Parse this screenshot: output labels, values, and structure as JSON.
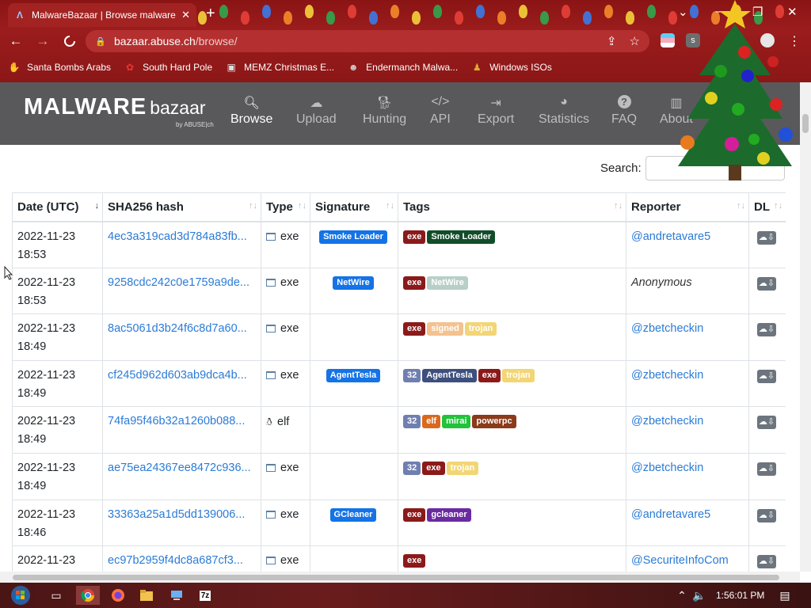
{
  "browser": {
    "tab_title": "MalwareBazaar | Browse malware",
    "url_domain": "bazaar.abuse.ch",
    "url_path": "/browse/",
    "bookmarks": [
      {
        "label": "Santa Bombs Arabs",
        "icon": "bomb-icon"
      },
      {
        "label": "South Hard Pole",
        "icon": "flower-icon"
      },
      {
        "label": "MEMZ Christmas E...",
        "icon": "image-icon"
      },
      {
        "label": "Endermanch Malwa...",
        "icon": "raccoon-icon"
      },
      {
        "label": "Windows ISOs",
        "icon": "person-icon"
      }
    ]
  },
  "site": {
    "logo_main": "MALWARE",
    "logo_sub": "bazaar",
    "logo_by": "by ABUSE|ch",
    "menu": [
      {
        "label": "Browse",
        "icon": "search-icon",
        "active": true
      },
      {
        "label": "Upload",
        "icon": "cloud-upload-icon"
      },
      {
        "label": "Hunting",
        "icon": "dog-icon"
      },
      {
        "label": "API",
        "icon": "code-icon"
      },
      {
        "label": "Export",
        "icon": "file-export-icon"
      },
      {
        "label": "Statistics",
        "icon": "pie-chart-icon"
      },
      {
        "label": "FAQ",
        "icon": "question-icon"
      },
      {
        "label": "About",
        "icon": "building-icon"
      }
    ],
    "search_label": "Search:"
  },
  "table": {
    "headers": [
      "Date (UTC)",
      "SHA256 hash",
      "Type",
      "Signature",
      "Tags",
      "Reporter",
      "DL"
    ],
    "rows": [
      {
        "date": "2022-11-23",
        "time": "18:53",
        "hash": "4ec3a319cad3d784a83fb...",
        "type": "exe",
        "signature": "Smoke Loader",
        "tags": [
          {
            "t": "exe",
            "c": "#8b1a1a"
          },
          {
            "t": "Smoke Loader",
            "c": "#124d2a"
          }
        ],
        "reporter": "@andretavare5"
      },
      {
        "date": "2022-11-23",
        "time": "18:53",
        "hash": "9258cdc242c0e1759a9de...",
        "type": "exe",
        "signature": "NetWire",
        "tags": [
          {
            "t": "exe",
            "c": "#8b1a1a"
          },
          {
            "t": "NetWire",
            "c": "#b8cfc7"
          }
        ],
        "reporter": "Anonymous"
      },
      {
        "date": "2022-11-23",
        "time": "18:49",
        "hash": "8ac5061d3b24f6c8d7a60...",
        "type": "exe",
        "signature": "",
        "tags": [
          {
            "t": "exe",
            "c": "#8b1a1a"
          },
          {
            "t": "signed",
            "c": "#f4c28f"
          },
          {
            "t": "trojan",
            "c": "#f2d675"
          }
        ],
        "reporter": "@zbetcheckin"
      },
      {
        "date": "2022-11-23",
        "time": "18:49",
        "hash": "cf245d962d603ab9dca4b...",
        "type": "exe",
        "signature": "AgentTesla",
        "tags": [
          {
            "t": "32",
            "c": "#6f7fb0"
          },
          {
            "t": "AgentTesla",
            "c": "#3d4f7c"
          },
          {
            "t": "exe",
            "c": "#8b1a1a"
          },
          {
            "t": "trojan",
            "c": "#f2d675"
          }
        ],
        "reporter": "@zbetcheckin"
      },
      {
        "date": "2022-11-23",
        "time": "18:49",
        "hash": "74fa95f46b32a1260b088...",
        "type": "elf",
        "signature": "",
        "tags": [
          {
            "t": "32",
            "c": "#6f7fb0"
          },
          {
            "t": "elf",
            "c": "#d9691e"
          },
          {
            "t": "mirai",
            "c": "#22c33a"
          },
          {
            "t": "powerpc",
            "c": "#8b3a1a"
          }
        ],
        "reporter": "@zbetcheckin"
      },
      {
        "date": "2022-11-23",
        "time": "18:49",
        "hash": "ae75ea24367ee8472c936...",
        "type": "exe",
        "signature": "",
        "tags": [
          {
            "t": "32",
            "c": "#6f7fb0"
          },
          {
            "t": "exe",
            "c": "#8b1a1a"
          },
          {
            "t": "trojan",
            "c": "#f2d675"
          }
        ],
        "reporter": "@zbetcheckin"
      },
      {
        "date": "2022-11-23",
        "time": "18:46",
        "hash": "33363a25a1d5dd139006...",
        "type": "exe",
        "signature": "GCleaner",
        "tags": [
          {
            "t": "exe",
            "c": "#8b1a1a"
          },
          {
            "t": "gcleaner",
            "c": "#6a2aa0"
          }
        ],
        "reporter": "@andretavare5"
      },
      {
        "date": "2022-11-23",
        "time": "",
        "hash": "ec97b2959f4dc8a687cf3...",
        "type": "exe",
        "signature": "",
        "tags": [
          {
            "t": "exe",
            "c": "#8b1a1a"
          }
        ],
        "reporter": "@SecuriteInfoCom"
      }
    ]
  },
  "taskbar": {
    "clock": "1:56:01 PM"
  }
}
